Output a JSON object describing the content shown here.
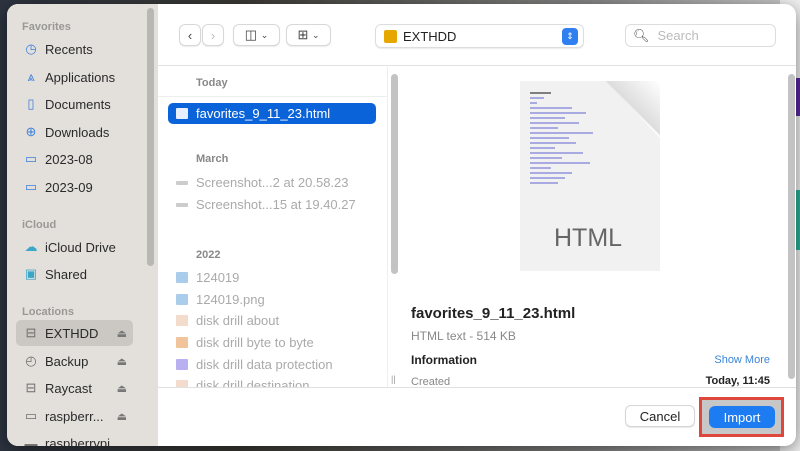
{
  "sidebar": {
    "sections": [
      {
        "title": "Favorites",
        "items": [
          {
            "label": "Recents",
            "icon": "clock-icon"
          },
          {
            "label": "Applications",
            "icon": "applications-icon"
          },
          {
            "label": "Documents",
            "icon": "document-icon"
          },
          {
            "label": "Downloads",
            "icon": "download-icon"
          },
          {
            "label": "2023-08",
            "icon": "folder-icon"
          },
          {
            "label": "2023-09",
            "icon": "folder-icon"
          }
        ]
      },
      {
        "title": "iCloud",
        "items": [
          {
            "label": "iCloud Drive",
            "icon": "cloud-icon"
          },
          {
            "label": "Shared",
            "icon": "shared-folder-icon"
          }
        ]
      },
      {
        "title": "Locations",
        "items": [
          {
            "label": "EXTHDD",
            "icon": "drive-icon",
            "selected": true
          },
          {
            "label": "Backup",
            "icon": "time-machine-icon"
          },
          {
            "label": "Raycast",
            "icon": "drive-icon"
          },
          {
            "label": "raspberr...",
            "icon": "computer-icon"
          },
          {
            "label": "raspberrypi",
            "icon": "server-icon"
          }
        ]
      }
    ]
  },
  "toolbar": {
    "location": "EXTHDD",
    "search_placeholder": "Search"
  },
  "file_list": {
    "groups": [
      {
        "title": "Today",
        "items": [
          "favorites_9_11_23.html"
        ]
      },
      {
        "title": "March",
        "items": [
          "Screenshot...2 at 20.58.23",
          "Screenshot...15 at 19.40.27"
        ]
      },
      {
        "title": "2022",
        "items": [
          "124019",
          "124019.png",
          "disk drill about",
          "disk drill byte to byte",
          "disk drill data protection",
          "disk drill destination"
        ]
      }
    ]
  },
  "preview": {
    "thumbnail_label": "HTML",
    "name": "favorites_9_11_23.html",
    "kind": "HTML text - 514 KB",
    "info_title": "Information",
    "show_more": "Show More",
    "created_label": "Created",
    "created_value": "Today, 11:45"
  },
  "footer": {
    "cancel": "Cancel",
    "import": "Import"
  },
  "colors": {
    "accent": "#1d7cf2",
    "highlight": "#e0473c",
    "selection": "#0b63d9"
  }
}
